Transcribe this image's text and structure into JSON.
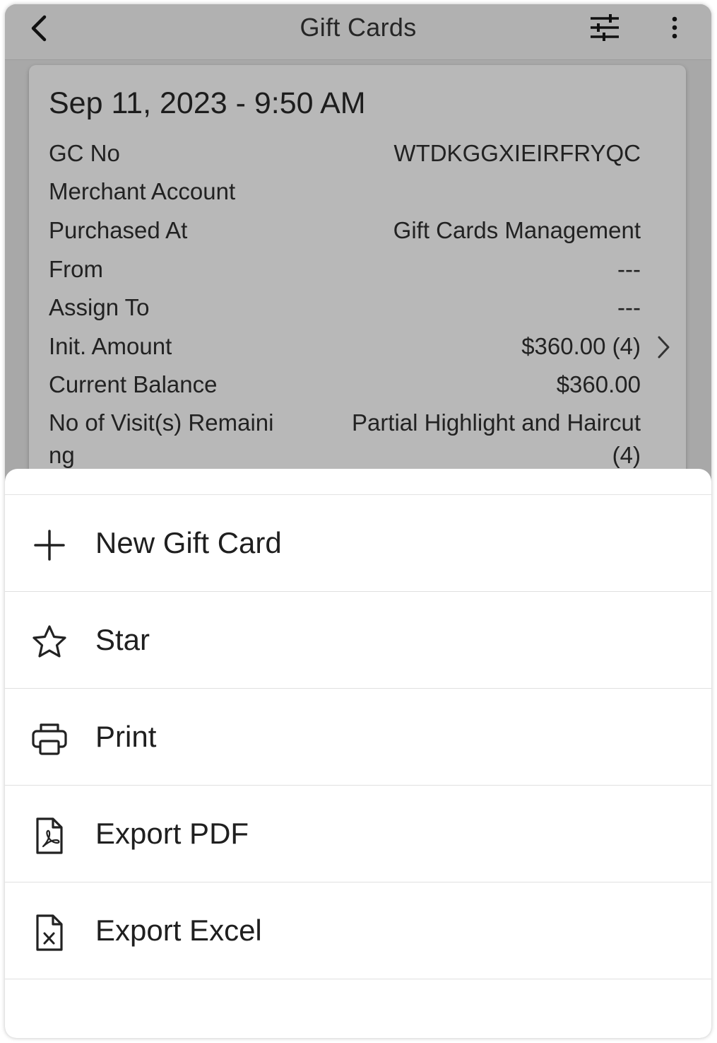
{
  "header": {
    "title": "Gift Cards",
    "back_icon": "chevron-left-icon",
    "filter_icon": "sliders-icon",
    "more_icon": "more-vertical-icon"
  },
  "card": {
    "date": "Sep 11, 2023 - 9:50 AM",
    "rows": [
      {
        "label": "GC No",
        "value": "WTDKGGXIEIRFRYQC"
      },
      {
        "label": "Merchant Account",
        "value": ""
      },
      {
        "label": "Purchased At",
        "value": "Gift Cards Management"
      },
      {
        "label": "From",
        "value": "---"
      },
      {
        "label": "Assign To",
        "value": "---"
      },
      {
        "label": "Init. Amount",
        "value": "$360.00 (4)"
      },
      {
        "label": "Current Balance",
        "value": "$360.00"
      },
      {
        "label_line1": "No of Visit(s) Remaini",
        "label_line2": "ng",
        "value_line1": "Partial Highlight and Haircut",
        "value_line2": "(4)"
      }
    ]
  },
  "sheet": {
    "items": [
      {
        "label": "New Gift Card",
        "icon": "plus-icon"
      },
      {
        "label": "Star",
        "icon": "star-icon"
      },
      {
        "label": "Print",
        "icon": "printer-icon"
      },
      {
        "label": "Export PDF",
        "icon": "pdf-file-icon"
      },
      {
        "label": "Export Excel",
        "icon": "excel-file-icon"
      }
    ]
  }
}
